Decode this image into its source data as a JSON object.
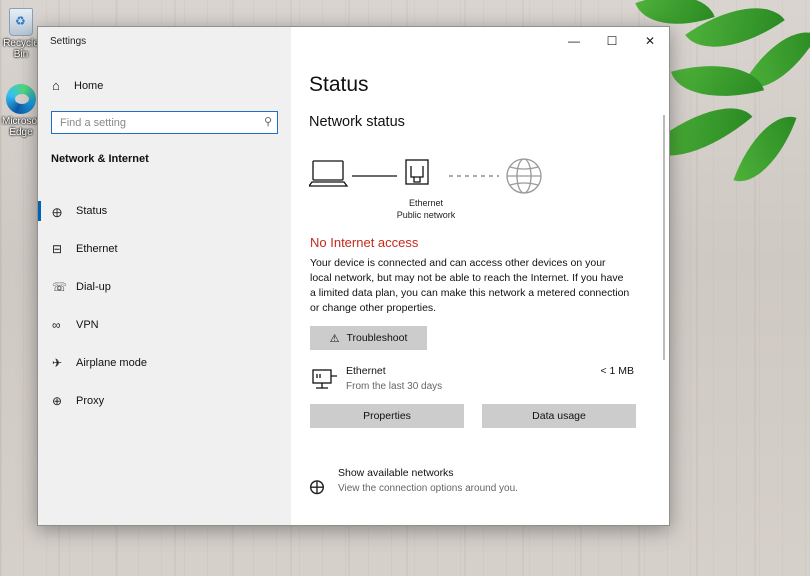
{
  "desktop": {
    "recycle_label": "Recycle Bin",
    "edge_label": "Microsoft Edge"
  },
  "window": {
    "title": "Settings",
    "controls": {
      "minimize": "—",
      "maximize": "☐",
      "close": "✕"
    }
  },
  "sidebar": {
    "home_label": "Home",
    "search_placeholder": "Find a setting",
    "section_title": "Network & Internet",
    "items": [
      {
        "label": "Status",
        "icon": "globe-status-icon",
        "active": true
      },
      {
        "label": "Ethernet",
        "icon": "ethernet-icon",
        "active": false
      },
      {
        "label": "Dial-up",
        "icon": "dialup-icon",
        "active": false
      },
      {
        "label": "VPN",
        "icon": "vpn-icon",
        "active": false
      },
      {
        "label": "Airplane mode",
        "icon": "airplane-icon",
        "active": false
      },
      {
        "label": "Proxy",
        "icon": "globe-icon",
        "active": false
      }
    ]
  },
  "main": {
    "title": "Status",
    "network_status_heading": "Network status",
    "adapter_name": "Ethernet",
    "network_type": "Public network",
    "alert": "No Internet access",
    "description": "Your device is connected and can access other devices on your local network, but may not be able to reach the Internet. If you have a limited data plan, you can make this network a metered connection or change other properties.",
    "troubleshoot_label": "Troubleshoot",
    "usage": {
      "name": "Ethernet",
      "period": "From the last 30 days",
      "amount": "< 1 MB"
    },
    "properties_label": "Properties",
    "data_usage_label": "Data usage",
    "show_networks_title": "Show available networks",
    "show_networks_sub": "View the connection options around you."
  },
  "colors": {
    "accent": "#0063b1",
    "alert": "#c42b1c",
    "sidebar_bg": "#f0f0f0",
    "button_bg": "#cccccc"
  }
}
